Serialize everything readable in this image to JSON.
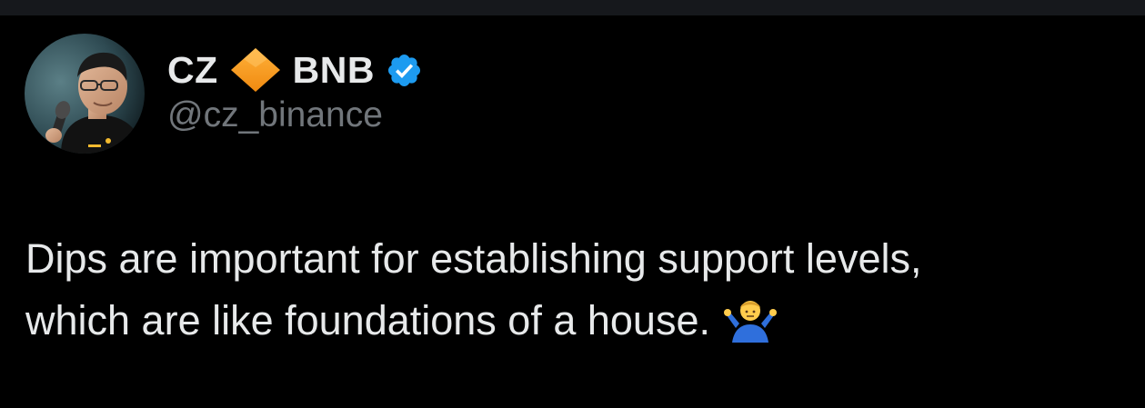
{
  "author": {
    "name_first": "CZ",
    "name_badge_icon": "orange-diamond-icon",
    "name_second": "BNB",
    "verified_icon": "verified-badge-icon",
    "handle": "@cz_binance",
    "avatar_icon": "profile-photo"
  },
  "tweet": {
    "line_1": "Dips are important for establishing support levels,",
    "line_2": "which are like foundations of a house.",
    "trailing_emoji_icon": "person-shrugging-icon"
  },
  "colors": {
    "background": "#000000",
    "top_strip": "#16181c",
    "text_primary": "#e7e9ea",
    "text_secondary": "#71767b",
    "verified_blue": "#1d9bf0",
    "diamond_orange": "#f7931a"
  }
}
